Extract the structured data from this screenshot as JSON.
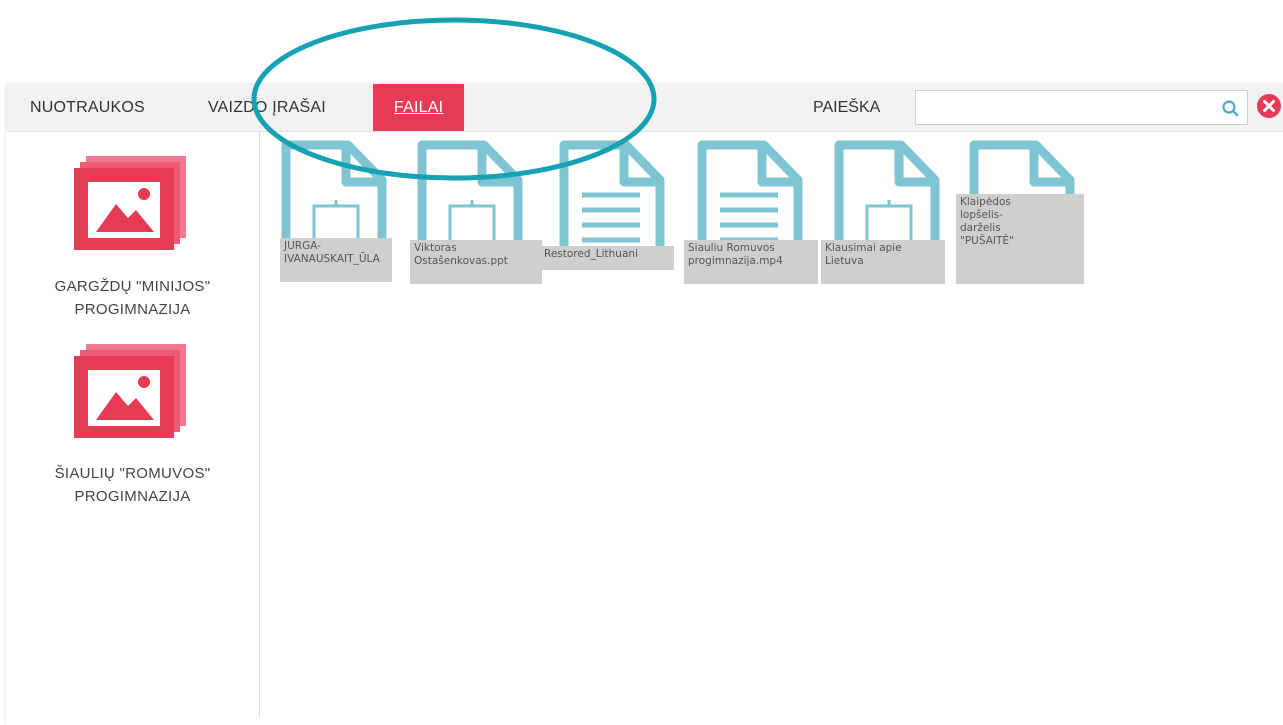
{
  "tabs": [
    {
      "label": "NUOTRAUKOS",
      "active": false
    },
    {
      "label": "VAIZDO ĮRAŠAI",
      "active": false
    },
    {
      "label": "FAILAI",
      "active": true
    }
  ],
  "search": {
    "label": "PAIEŠKA",
    "value": "",
    "placeholder": ""
  },
  "sidebar": {
    "items": [
      {
        "name_line1": "GARGŽDŲ \"MINIJOS\"",
        "name_line2": "PROGIMNAZIJA",
        "icon": "gallery-icon"
      },
      {
        "name_line1": "ŠIAULIŲ \"ROMUVOS\"",
        "name_line2": "PROGIMNAZIJA",
        "icon": "gallery-icon"
      }
    ]
  },
  "files": [
    {
      "label": "JURGA-\nIVANAUSKAIT_ŪLA",
      "icon": "file-media-icon"
    },
    {
      "label": "Viktoras\nOstaŝenkovas.ppt",
      "icon": "file-media-icon"
    },
    {
      "label": "Restored_Lithuani",
      "icon": "file-text-icon"
    },
    {
      "label": "Siauliu Romuvos\nprogimnazija.mp4",
      "icon": "file-text-icon"
    },
    {
      "label": "Klausimai apie\nLietuva",
      "icon": "file-media-icon"
    },
    {
      "label": "Klaipėdos\nlopšelis-\ndarželis\n\"PUŠAITĖ\"",
      "icon": "file-blank-icon"
    }
  ],
  "colors": {
    "accent": "#e63a55",
    "file_icon": "#7fc4d2",
    "annotation": "#16a2b2"
  }
}
